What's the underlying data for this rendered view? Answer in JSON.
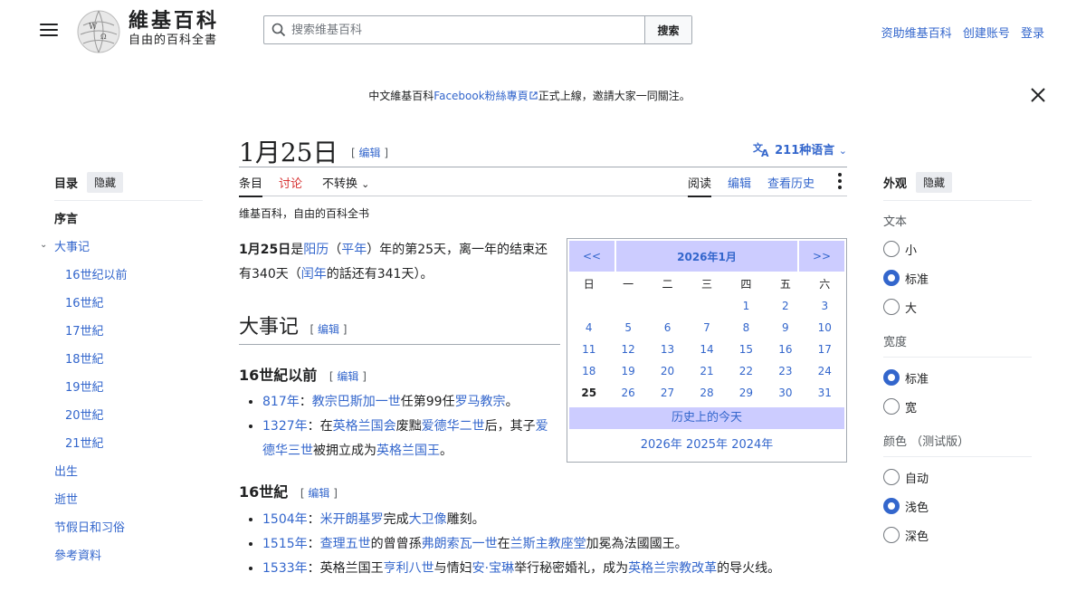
{
  "header": {
    "site_name": "維基百科",
    "site_tagline": "自由的百科全書",
    "search_placeholder": "搜索维基百科",
    "search_button": "搜索",
    "user_links": [
      "资助维基百科",
      "创建账号",
      "登录"
    ]
  },
  "banner": {
    "prefix": "中文維基百科",
    "link": "Facebook粉絲專頁",
    "suffix": "正式上線，邀請大家一同關注。"
  },
  "toc": {
    "title": "目录",
    "hide": "隐藏",
    "items": [
      {
        "label": "序言",
        "level": 0
      },
      {
        "label": "大事记",
        "level": 0
      },
      {
        "label": "16世纪以前",
        "level": 1
      },
      {
        "label": "16世紀",
        "level": 1
      },
      {
        "label": "17世紀",
        "level": 1
      },
      {
        "label": "18世紀",
        "level": 1
      },
      {
        "label": "19世紀",
        "level": 1
      },
      {
        "label": "20世紀",
        "level": 1
      },
      {
        "label": "21世紀",
        "level": 1
      },
      {
        "label": "出生",
        "level": 0
      },
      {
        "label": "逝世",
        "level": 0
      },
      {
        "label": "节假日和习俗",
        "level": 0
      },
      {
        "label": "參考資料",
        "level": 0
      }
    ]
  },
  "article": {
    "title": "1月25日",
    "edit": "编辑",
    "languages": "211种语言",
    "tabs": {
      "article": "条目",
      "talk": "讨论",
      "variant": "不转换",
      "read": "阅读",
      "edit": "编辑",
      "history": "查看历史"
    },
    "tagline": "维基百科，自由的百科全书",
    "lead": {
      "date": "1月25日",
      "t1": "是",
      "l1": "阳历",
      "t2": "（",
      "l2": "平年",
      "t3": "）年的第25天，离一年的结束还有340天（",
      "l3": "闰年",
      "t4": "的話还有341天）。"
    },
    "section_title": "大事记",
    "sub1": {
      "title": "16世紀以前",
      "items": [
        {
          "year": "817年",
          "parts": [
            {
              "t": "："
            },
            {
              "l": "教宗巴斯加一世"
            },
            {
              "t": "任第99任"
            },
            {
              "l": "罗马教宗"
            },
            {
              "t": "。"
            }
          ]
        },
        {
          "year": "1327年",
          "parts": [
            {
              "t": "：在"
            },
            {
              "l": "英格兰国会"
            },
            {
              "t": "废黜"
            },
            {
              "l": "爱德华二世"
            },
            {
              "t": "后，其子"
            },
            {
              "l": "爱德华三世"
            },
            {
              "t": "被拥立成为"
            },
            {
              "l": "英格兰国王"
            },
            {
              "t": "。"
            }
          ]
        }
      ]
    },
    "sub2": {
      "title": "16世紀",
      "items": [
        {
          "year": "1504年",
          "parts": [
            {
              "t": "："
            },
            {
              "l": "米开朗基罗"
            },
            {
              "t": "完成"
            },
            {
              "l": "大卫像"
            },
            {
              "t": "雕刻。"
            }
          ]
        },
        {
          "year": "1515年",
          "parts": [
            {
              "t": "："
            },
            {
              "l": "查理五世"
            },
            {
              "t": "的曾曾孫"
            },
            {
              "l": "弗朗索瓦一世"
            },
            {
              "t": "在"
            },
            {
              "l": "兰斯主教座堂"
            },
            {
              "t": "加冕為法國國王。"
            }
          ]
        },
        {
          "year": "1533年",
          "parts": [
            {
              "t": "：英格兰国王"
            },
            {
              "l": "亨利八世"
            },
            {
              "t": "与情妇"
            },
            {
              "l": "安·宝琳"
            },
            {
              "t": "举行秘密婚礼，成为"
            },
            {
              "l": "英格兰宗教改革"
            },
            {
              "t": "的导火线。"
            }
          ]
        }
      ]
    }
  },
  "calendar": {
    "prev": "<<",
    "month": "2026年1月",
    "next": ">>",
    "weekdays": [
      "日",
      "一",
      "二",
      "三",
      "四",
      "五",
      "六"
    ],
    "days": [
      "",
      "",
      "",
      "",
      "1",
      "2",
      "3",
      "4",
      "5",
      "6",
      "7",
      "8",
      "9",
      "10",
      "11",
      "12",
      "13",
      "14",
      "15",
      "16",
      "17",
      "18",
      "19",
      "20",
      "21",
      "22",
      "23",
      "24",
      "25",
      "26",
      "27",
      "28",
      "29",
      "30",
      "31"
    ],
    "today_day": "25",
    "today_label": "历史上的今天",
    "years": [
      "2026年",
      "2025年",
      "2024年"
    ]
  },
  "appearance": {
    "title": "外观",
    "hide": "隐藏",
    "text_label": "文本",
    "text_options": [
      {
        "label": "小",
        "on": false
      },
      {
        "label": "标准",
        "on": true
      },
      {
        "label": "大",
        "on": false
      }
    ],
    "width_label": "宽度",
    "width_options": [
      {
        "label": "标准",
        "on": true
      },
      {
        "label": "宽",
        "on": false
      }
    ],
    "color_label": "颜色 （测试版）",
    "color_options": [
      {
        "label": "自动",
        "on": false
      },
      {
        "label": "浅色",
        "on": true
      },
      {
        "label": "深色",
        "on": false
      }
    ]
  },
  "colors": {
    "link": "#3366cc",
    "accent": "#ccccff",
    "talk": "#d73333"
  }
}
